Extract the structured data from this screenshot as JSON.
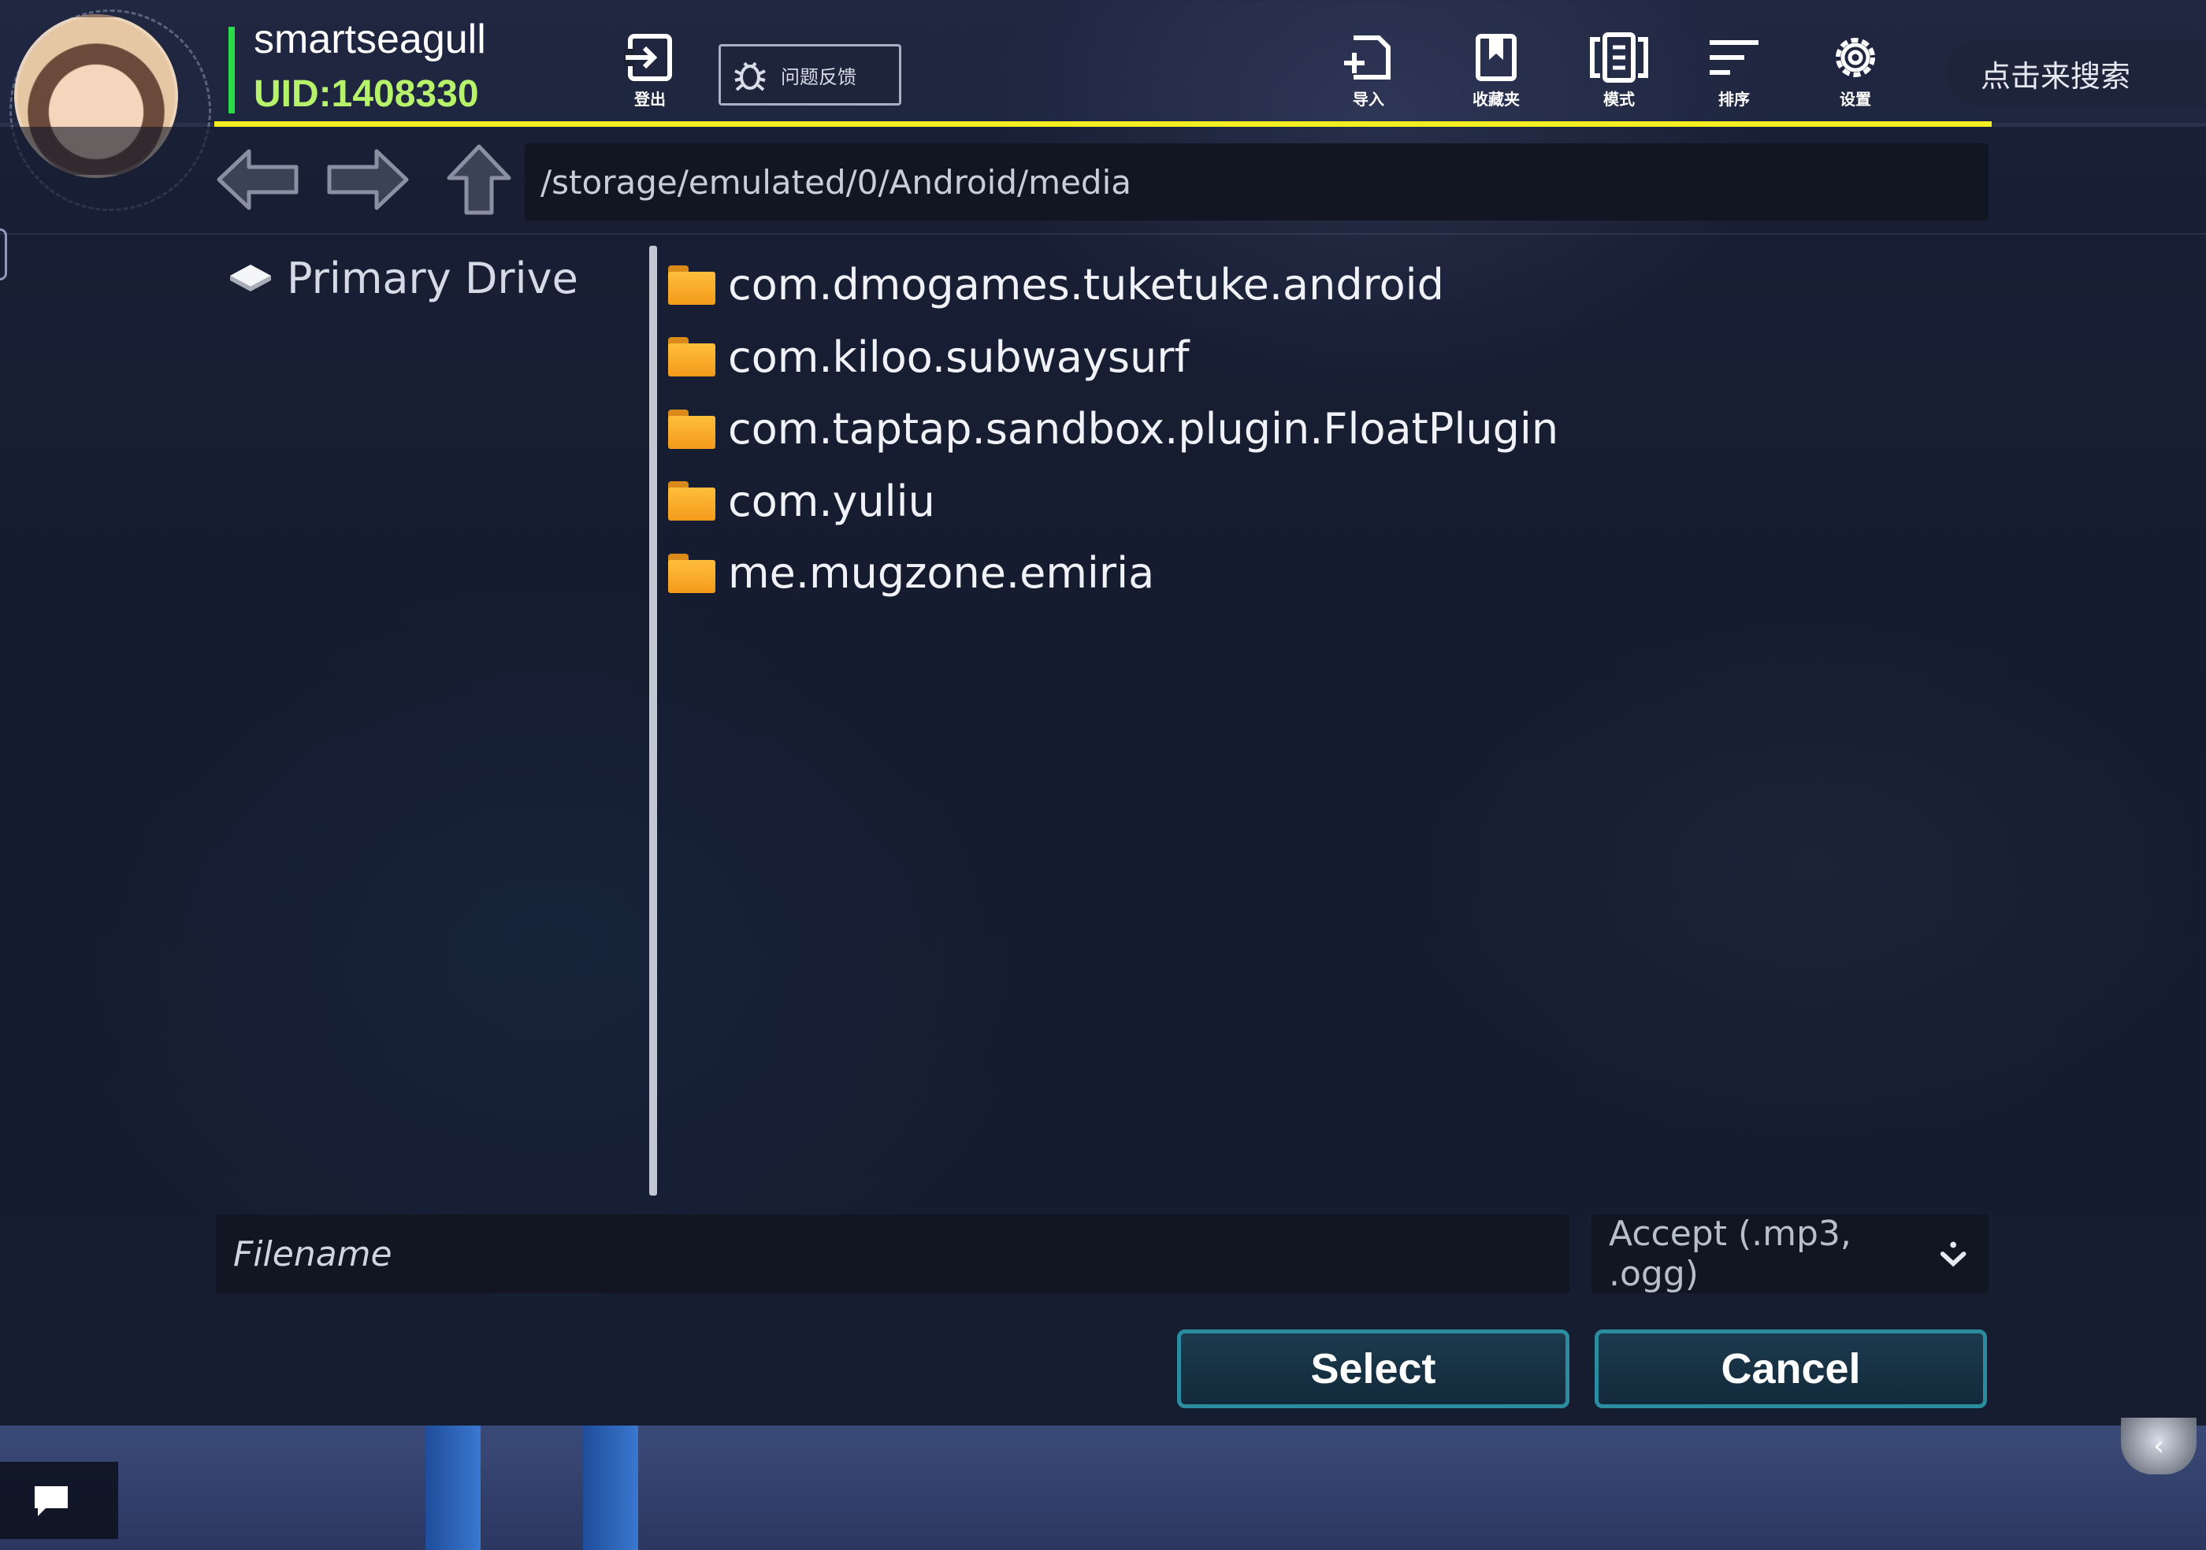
{
  "user": {
    "name": "smartseagull",
    "uid": "UID:1408330"
  },
  "toolbar": {
    "logout": "登出",
    "feedback": "问题反馈",
    "import": "导入",
    "favorites": "收藏夹",
    "mode": "模式",
    "sort": "排序",
    "settings": "设置",
    "search_placeholder": "点击来搜索"
  },
  "browser": {
    "path": "/storage/emulated/0/Android/media",
    "drive_label": "Primary Drive",
    "files": [
      "com.dmogames.tuketuke.android",
      "com.kiloo.subwaysurf",
      "com.taptap.sandbox.plugin.FloatPlugin",
      "com.yuliu",
      "me.mugzone.emiria"
    ],
    "filename_placeholder": "Filename",
    "filter": "Accept (.mp3, .ogg)",
    "select_label": "Select",
    "cancel_label": "Cancel"
  },
  "colors": {
    "accent_line": "#f3ee22",
    "uid": "#b7f36a",
    "online_bar": "#2bdc4a",
    "button_border": "#2a8c9e",
    "folder": "#ffb52e"
  }
}
